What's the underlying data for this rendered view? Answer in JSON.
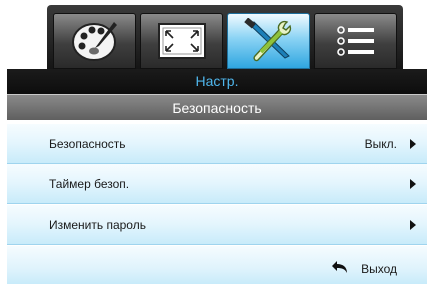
{
  "tabs": [
    {
      "name": "image-tab",
      "icon": "palette-icon",
      "active": false
    },
    {
      "name": "display-tab",
      "icon": "screen-aspect-icon",
      "active": false
    },
    {
      "name": "setup-tab",
      "icon": "tools-icon",
      "active": true
    },
    {
      "name": "options-tab",
      "icon": "list-icon",
      "active": false
    }
  ],
  "header": {
    "title": "Настр."
  },
  "submenu": {
    "title": "Безопасность"
  },
  "rows": [
    {
      "label": "Безопасность",
      "value": "Выкл."
    },
    {
      "label": "Таймер безоп.",
      "value": ""
    },
    {
      "label": "Изменить пароль",
      "value": ""
    }
  ],
  "footer": {
    "exit_label": "Выход"
  },
  "colors": {
    "accent": "#4fb6ec",
    "row_bg": "#e3f5fd",
    "header_bg": "#111111"
  }
}
